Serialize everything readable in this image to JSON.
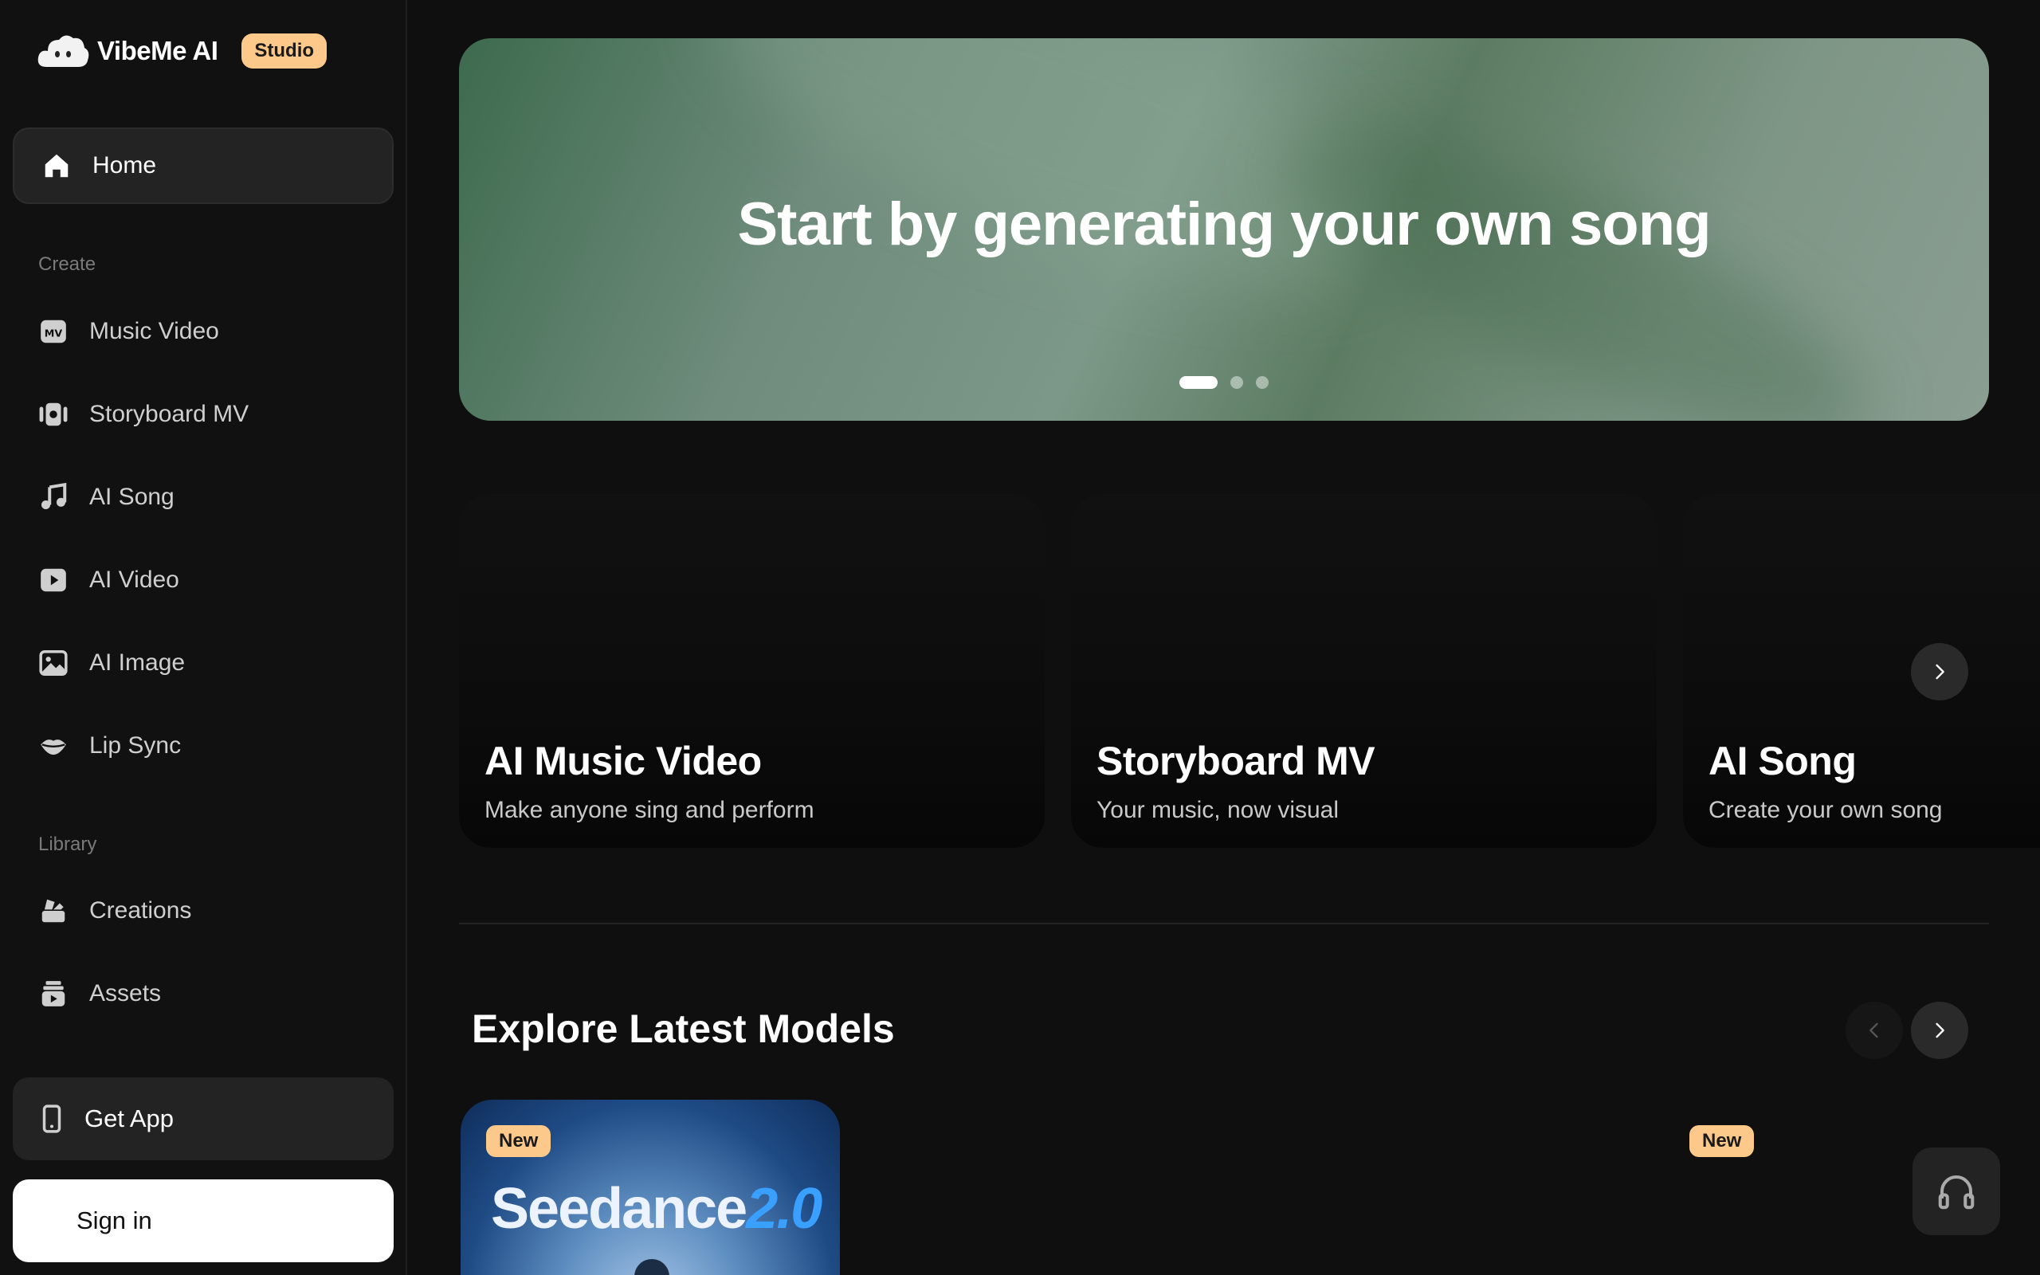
{
  "brand": {
    "name": "VibeMe AI",
    "badge": "Studio"
  },
  "sidebar": {
    "home": "Home",
    "create_label": "Create",
    "create_items": [
      {
        "label": "Music Video",
        "icon": "mv-icon"
      },
      {
        "label": "Storyboard MV",
        "icon": "storyboard-icon"
      },
      {
        "label": "AI Song",
        "icon": "music-note-icon"
      },
      {
        "label": "AI Video",
        "icon": "play-icon"
      },
      {
        "label": "AI Image",
        "icon": "image-icon"
      },
      {
        "label": "Lip Sync",
        "icon": "lips-icon"
      }
    ],
    "library_label": "Library",
    "library_items": [
      {
        "label": "Creations",
        "icon": "creations-icon"
      },
      {
        "label": "Assets",
        "icon": "assets-icon"
      }
    ],
    "get_app": "Get App",
    "sign_in": "Sign in"
  },
  "hero": {
    "title": "Start by generating your own song",
    "slides": 3,
    "active_slide": 1
  },
  "features": [
    {
      "title": "AI Music Video",
      "subtitle": "Make anyone sing and perform"
    },
    {
      "title": "Storyboard MV",
      "subtitle": "Your music, now visual"
    },
    {
      "title": "AI Song",
      "subtitle": "Create your own song"
    }
  ],
  "models": {
    "title": "Explore Latest Models",
    "cards": [
      {
        "badge": "New",
        "brand": "Seedance",
        "version": "2.0"
      },
      {
        "badge": "New"
      }
    ]
  },
  "colors": {
    "accent": "#fcc98a",
    "background": "#0f0f0f",
    "sidebar": "#111111"
  }
}
